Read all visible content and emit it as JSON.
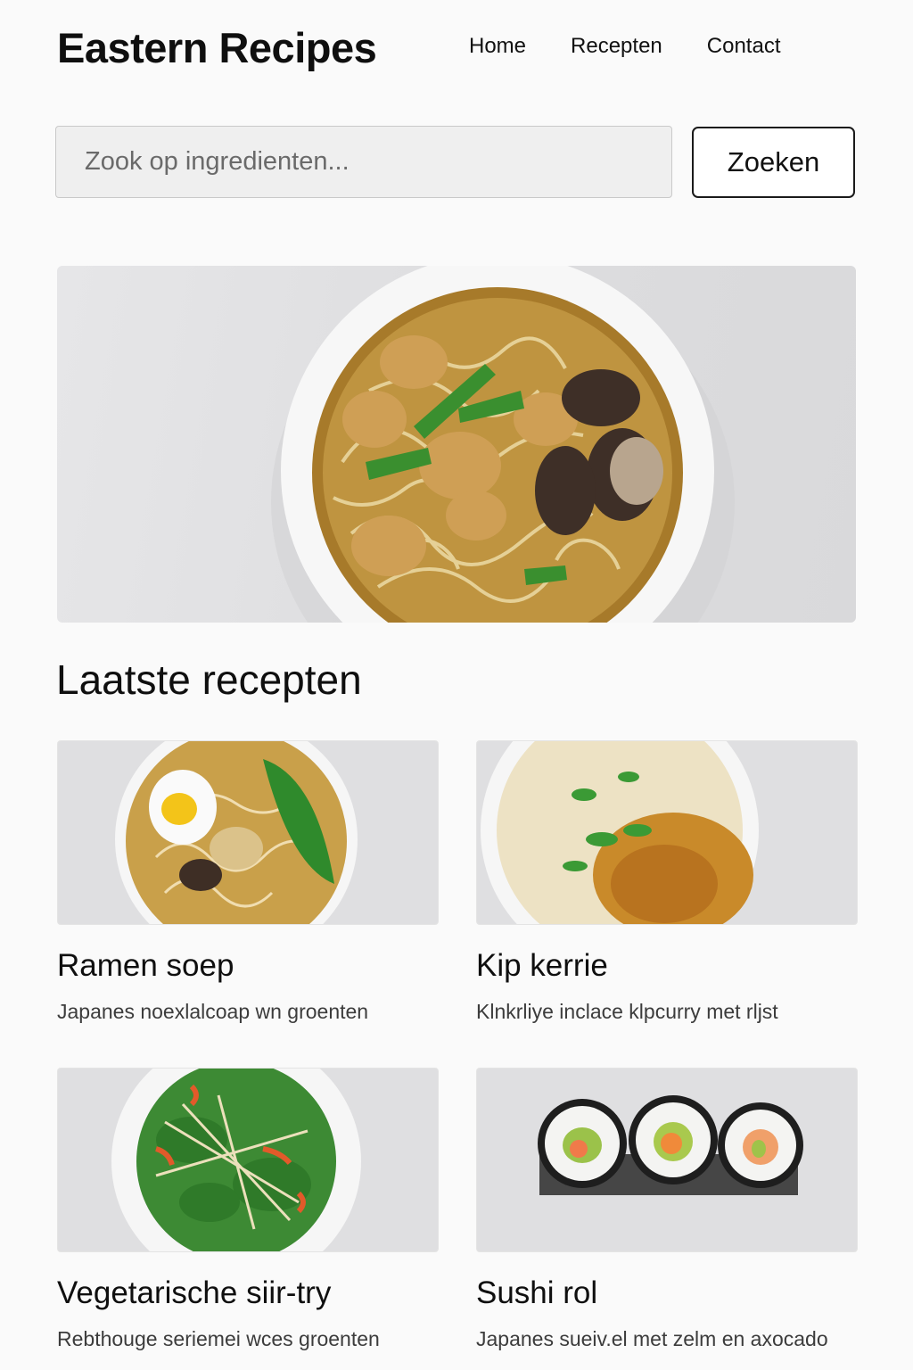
{
  "header": {
    "logo": "Eastern Recipes",
    "nav": [
      "Home",
      "Recepten",
      "Contact"
    ]
  },
  "search": {
    "placeholder": "Zook op ingredienten...",
    "button_label": "Zoeken"
  },
  "hero": {
    "image": "noodle-soup-bowl-image"
  },
  "section": {
    "title": "Laatste recepten"
  },
  "recipes": [
    {
      "title": "Ramen soep",
      "desc": "Japanes noexlalcoap wn groenten",
      "image": "ramen-bowl-image"
    },
    {
      "title": "Kip kerrie",
      "desc": "Klnkrliye inclace klpcurry met rljst",
      "image": "chicken-curry-rice-image"
    },
    {
      "title": "Vegetarische siir-try",
      "desc": "Rebthouge seriemei wces groenten",
      "image": "vegetable-stirfry-image"
    },
    {
      "title": "Sushi rol",
      "desc": "Japanes sueiv.el met zelm en axocado",
      "image": "sushi-rolls-image"
    }
  ]
}
